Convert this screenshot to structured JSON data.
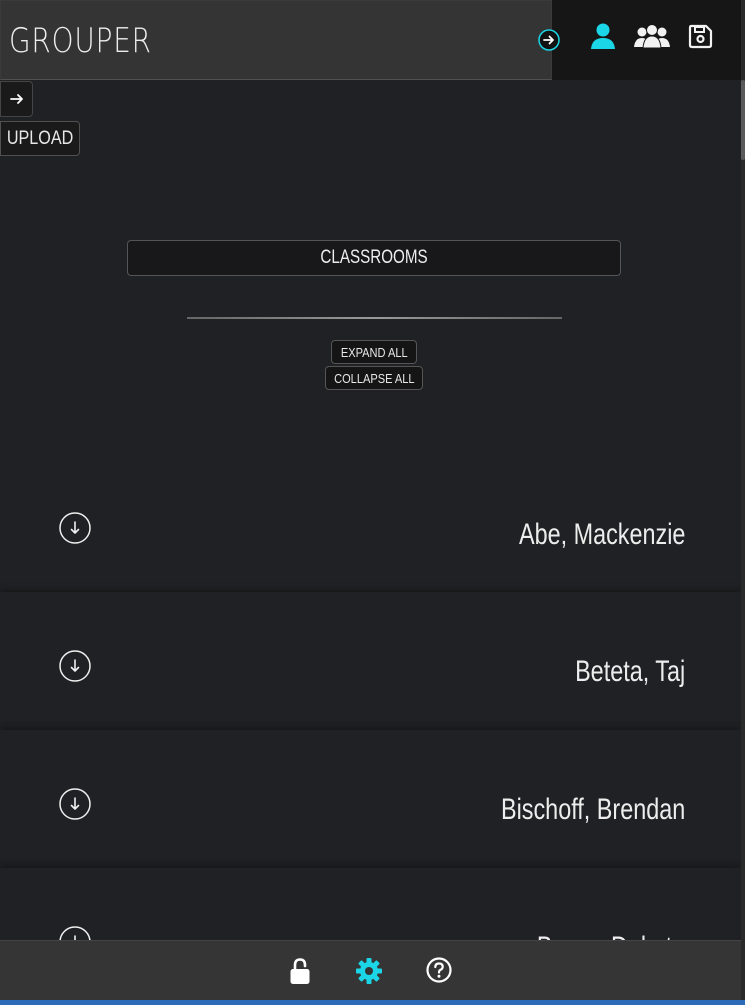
{
  "header": {
    "title": "GROUPER",
    "icons": [
      "arrow-right-circle-icon",
      "single-user-icon",
      "group-users-icon",
      "save-icon"
    ],
    "accent": "#1ad6e6"
  },
  "sidebar": {
    "arrow_icon": "arrow-right-icon",
    "upload_label": "UPLOAD"
  },
  "main": {
    "classrooms_label": "CLASSROOMS",
    "expand_all_label": "EXPAND ALL",
    "collapse_all_label": "COLLAPSE ALL"
  },
  "students": [
    {
      "name": "Abe, Mackenzie"
    },
    {
      "name": "Beteta, Taj"
    },
    {
      "name": "Bischoff, Brendan"
    },
    {
      "name": "Bryan, Dakota"
    }
  ],
  "footer": {
    "icons": [
      "lock-icon",
      "gear-icon",
      "help-icon"
    ]
  },
  "colors": {
    "background": "#202124",
    "header": "#161617",
    "title_box": "#343434",
    "footer": "#353535",
    "accent": "#1ad6e6"
  }
}
